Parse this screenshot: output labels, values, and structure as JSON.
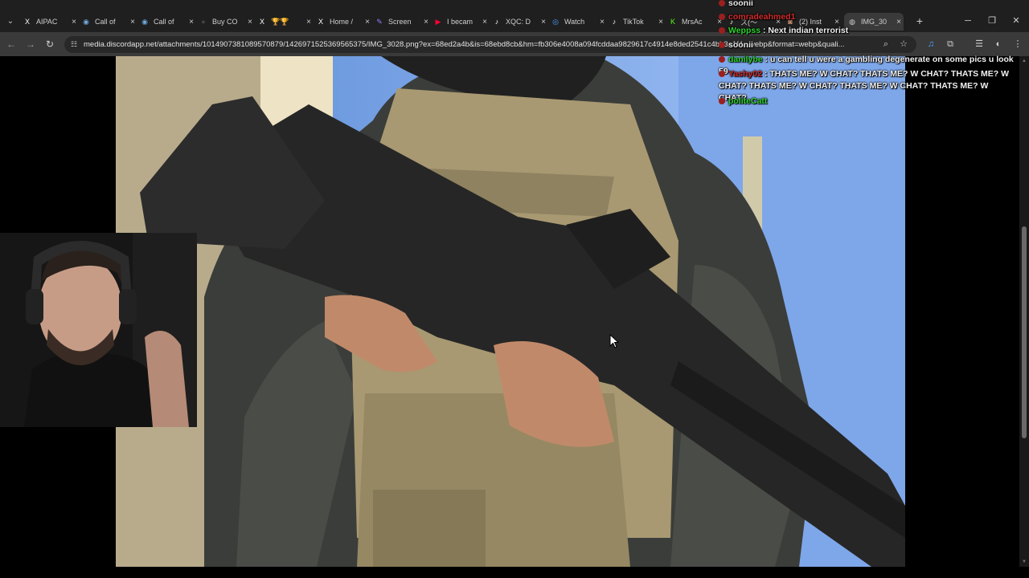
{
  "browser": {
    "tabs": [
      {
        "title": "AIPAC",
        "icon": "x-logo-icon",
        "glyph": "X",
        "color": "#ffffff"
      },
      {
        "title": "Call of",
        "icon": "steam-icon",
        "glyph": "◉",
        "color": "#6fa8dc"
      },
      {
        "title": "Call of",
        "icon": "steam-icon",
        "glyph": "◉",
        "color": "#6fa8dc"
      },
      {
        "title": "Buy CO",
        "icon": "steam-icon",
        "glyph": "●",
        "color": "#444444"
      },
      {
        "title": "🏆🏆",
        "icon": "x-logo-icon",
        "glyph": "X",
        "color": "#ffffff"
      },
      {
        "title": "Home /",
        "icon": "x-logo-icon",
        "glyph": "X",
        "color": "#ffffff"
      },
      {
        "title": "Screen",
        "icon": "pen-icon",
        "glyph": "✎",
        "color": "#9b7bff"
      },
      {
        "title": "I becam",
        "icon": "youtube-icon",
        "glyph": "▶",
        "color": "#ff0033"
      },
      {
        "title": "XQC: D",
        "icon": "tiktok-icon",
        "glyph": "♪",
        "color": "#ffffff"
      },
      {
        "title": "Watch",
        "icon": "globe-icon",
        "glyph": "◎",
        "color": "#4aa3ff"
      },
      {
        "title": "TikTok",
        "icon": "tiktok-icon",
        "glyph": "♪",
        "color": "#ffffff"
      },
      {
        "title": "MrsAc",
        "icon": "kick-icon",
        "glyph": "K",
        "color": "#53fc18"
      },
      {
        "title": "ス(〜",
        "icon": "tiktok-icon",
        "glyph": "♪",
        "color": "#ffffff"
      },
      {
        "title": "(2) Inst",
        "icon": "avatar-icon",
        "glyph": "◙",
        "color": "#c58b6a"
      },
      {
        "title": "IMG_30",
        "icon": "globe-icon",
        "glyph": "◍",
        "color": "#cccccc",
        "active": true
      }
    ],
    "url": "media.discordapp.net/attachments/1014907381089570879/1426971525369565375/IMG_3028.png?ex=68ed2a4b&is=68ebd8cb&hm=fb306e4008a094fcddaa9829617c4914e8ded2541c4bb3a1f4...webp&format=webp&quali...",
    "new_tab": "+",
    "minimize": "─",
    "restore": "❐",
    "close": "✕",
    "tab_close": "×",
    "back": "←",
    "forward": "→",
    "reload": "↻",
    "tab_menu": "⌄"
  },
  "chat": [
    {
      "user": "soonii",
      "user_color": "#e8e8e8",
      "text": ""
    },
    {
      "user": "comradeahmed1",
      "user_color": "#d22b2b",
      "text": ""
    },
    {
      "user": "Weppss",
      "user_color": "#2fd12f",
      "text": "Next indian terrorist"
    },
    {
      "user": "soonii",
      "user_color": "#e8e8e8",
      "text": ""
    },
    {
      "user": "danilybe",
      "user_color": "#2fd12f",
      "text": "u can tell u were a gambling degenerate on some pics u look 59"
    },
    {
      "user": "Yashy02",
      "user_color": "#d22b2b",
      "text": "THATS ME? W CHAT? THATS ME? W CHAT? THATS ME? W CHAT? THATS ME? W CHAT? THATS ME? W CHAT? THATS ME? W CHAT?"
    },
    {
      "user": "politeCatt",
      "user_color": "#2fd12f",
      "text": ""
    }
  ]
}
